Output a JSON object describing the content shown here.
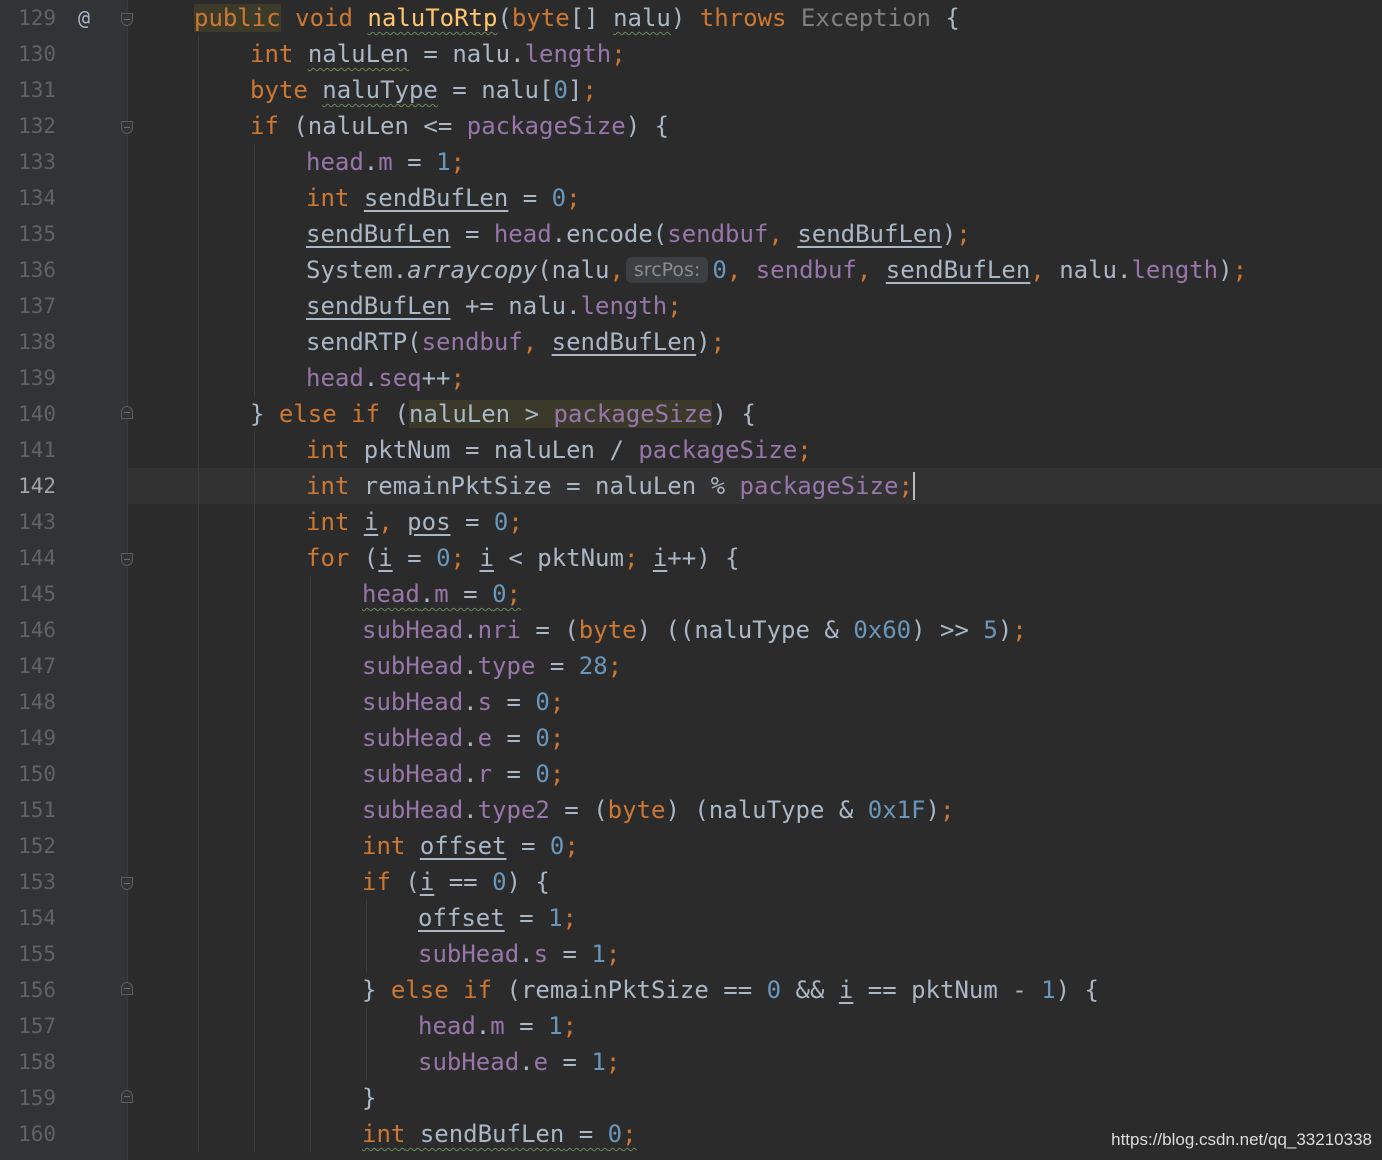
{
  "editor": {
    "language": "Java",
    "current_line": "142",
    "colors": {
      "background": "#2b2b2b",
      "gutter": "#313335",
      "keyword": "#cc7832",
      "function": "#ffc66d",
      "field": "#9876aa",
      "number": "#6897bb",
      "text": "#a9b7c6"
    }
  },
  "gutter": {
    "override_marker": "@",
    "line_numbers": [
      "129",
      "130",
      "131",
      "132",
      "133",
      "134",
      "135",
      "136",
      "137",
      "138",
      "139",
      "140",
      "141",
      "142",
      "143",
      "144",
      "145",
      "146",
      "147",
      "148",
      "149",
      "150",
      "151",
      "152",
      "153",
      "154",
      "155",
      "156",
      "157",
      "158",
      "159",
      "160"
    ]
  },
  "code": {
    "l129": {
      "t1": "public",
      "t2": " ",
      "t3": "void",
      "t4": " ",
      "t5": "naluToRtp",
      "t6": "(",
      "t7": "byte",
      "t8": "[] ",
      "t9": "nalu",
      "t10": ") ",
      "t11": "throws",
      "t12": " ",
      "t13": "Exception",
      "t14": " {"
    },
    "l130": {
      "t1": "int",
      "t2": " ",
      "t3": "naluLen",
      "t4": " = nalu.",
      "t5": "length",
      "t6": ";"
    },
    "l131": {
      "t1": "byte",
      "t2": " ",
      "t3": "naluType",
      "t4": " = nalu[",
      "t5": "0",
      "t6": "]",
      "t7": ";"
    },
    "l132": {
      "t1": "if",
      "t2": " (naluLen <= ",
      "t3": "packageSize",
      "t4": ") {"
    },
    "l133": {
      "t1": "head",
      "t2": ".",
      "t3": "m",
      "t4": " = ",
      "t5": "1",
      "t6": ";"
    },
    "l134": {
      "t1": "int",
      "t2": " ",
      "t3": "sendBufLen",
      "t4": " = ",
      "t5": "0",
      "t6": ";"
    },
    "l135": {
      "t1": "sendBufLen",
      "t2": " = ",
      "t3": "head",
      "t4": ".encode(",
      "t5": "sendbuf",
      "t6": ", ",
      "t7": "sendBufLen",
      "t8": ")",
      "t9": ";"
    },
    "l136": {
      "t1": "System.",
      "t2": "arraycopy",
      "t3": "(nalu",
      "t4": ",",
      "hint": "srcPos:",
      "t5": "0",
      "t6": ", ",
      "t7": "sendbuf",
      "t8": ", ",
      "t9": "sendBufLen",
      "t10": ", ",
      "t11": "nalu.",
      "t12": "length",
      "t13": ")",
      "t14": ";"
    },
    "l137": {
      "t1": "sendBufLen",
      "t2": " += nalu.",
      "t3": "length",
      "t4": ";"
    },
    "l138": {
      "t1": "sendRTP(",
      "t2": "sendbuf",
      "t3": ", ",
      "t4": "sendBufLen",
      "t5": ")",
      "t6": ";"
    },
    "l139": {
      "t1": "head",
      "t2": ".",
      "t3": "seq",
      "t4": "++",
      "t5": ";"
    },
    "l140": {
      "t1": "} ",
      "t2": "else if",
      "t3": " (",
      "t4": "naluLen > ",
      "t5": "packageSize",
      "t6": ") {"
    },
    "l141": {
      "t1": "int",
      "t2": " pktNum = naluLen / ",
      "t3": "packageSize",
      "t4": ";"
    },
    "l142": {
      "t1": "int",
      "t2": " remainPktSize = naluLen % ",
      "t3": "packageSize",
      "t4": ";"
    },
    "l143": {
      "t1": "int",
      "t2": " ",
      "t3": "i",
      "t4": ", ",
      "t5": "pos",
      "t6": " = ",
      "t7": "0",
      "t8": ";"
    },
    "l144": {
      "t1": "for",
      "t2": " (",
      "t3": "i",
      "t4": " = ",
      "t5": "0",
      "t6": "; ",
      "t7": "i",
      "t8": " < pktNum",
      "t9": "; ",
      "t10": "i",
      "t11": "++) {"
    },
    "l145": {
      "t1": "head",
      "t2": ".",
      "t3": "m",
      "t4": " = ",
      "t5": "0",
      "t6": ";"
    },
    "l146": {
      "t1": "subHead",
      "t2": ".",
      "t3": "nri",
      "t4": " = (",
      "t5": "byte",
      "t6": ") ((naluType & ",
      "t7": "0x60",
      "t8": ") >> ",
      "t9": "5",
      "t10": ")",
      "t11": ";"
    },
    "l147": {
      "t1": "subHead",
      "t2": ".",
      "t3": "type",
      "t4": " = ",
      "t5": "28",
      "t6": ";"
    },
    "l148": {
      "t1": "subHead",
      "t2": ".",
      "t3": "s",
      "t4": " = ",
      "t5": "0",
      "t6": ";"
    },
    "l149": {
      "t1": "subHead",
      "t2": ".",
      "t3": "e",
      "t4": " = ",
      "t5": "0",
      "t6": ";"
    },
    "l150": {
      "t1": "subHead",
      "t2": ".",
      "t3": "r",
      "t4": " = ",
      "t5": "0",
      "t6": ";"
    },
    "l151": {
      "t1": "subHead",
      "t2": ".",
      "t3": "type2",
      "t4": " = (",
      "t5": "byte",
      "t6": ") (naluType & ",
      "t7": "0x1F",
      "t8": ")",
      "t9": ";"
    },
    "l152": {
      "t1": "int",
      "t2": " ",
      "t3": "offset",
      "t4": " = ",
      "t5": "0",
      "t6": ";"
    },
    "l153": {
      "t1": "if",
      "t2": " (",
      "t3": "i",
      "t4": " == ",
      "t5": "0",
      "t6": ") {"
    },
    "l154": {
      "t1": "offset",
      "t2": " = ",
      "t3": "1",
      "t4": ";"
    },
    "l155": {
      "t1": "subHead",
      "t2": ".",
      "t3": "s",
      "t4": " = ",
      "t5": "1",
      "t6": ";"
    },
    "l156": {
      "t1": "} ",
      "t2": "else if",
      "t3": " (remainPktSize == ",
      "t4": "0",
      "t5": " && ",
      "t6": "i",
      "t7": " == pktNum - ",
      "t8": "1",
      "t9": ") {"
    },
    "l157": {
      "t1": "head",
      "t2": ".",
      "t3": "m",
      "t4": " = ",
      "t5": "1",
      "t6": ";"
    },
    "l158": {
      "t1": "subHead",
      "t2": ".",
      "t3": "e",
      "t4": " = ",
      "t5": "1",
      "t6": ";"
    },
    "l159": {
      "t1": "}"
    },
    "l160": {
      "t1": "int",
      "t2": " ",
      "t3": "sendBufLen",
      "t4": " = ",
      "t5": "0",
      "t6": ";"
    }
  },
  "watermark": "https://blog.csdn.net/qq_33210338"
}
